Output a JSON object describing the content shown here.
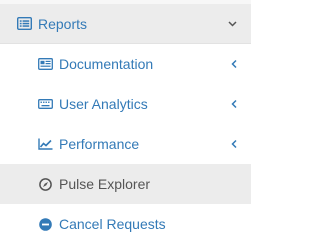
{
  "menu": {
    "header": {
      "label": "Reports",
      "icon": "list-alt-icon",
      "state_icon": "chevron-down-icon"
    },
    "items": [
      {
        "label": "Documentation",
        "icon": "newspaper-icon",
        "expand_icon": "chevron-left-icon"
      },
      {
        "label": "User Analytics",
        "icon": "keyboard-icon",
        "expand_icon": "chevron-left-icon"
      },
      {
        "label": "Performance",
        "icon": "line-chart-icon",
        "expand_icon": "chevron-left-icon"
      },
      {
        "label": "Pulse Explorer",
        "icon": "compass-icon",
        "active": true
      },
      {
        "label": "Cancel Requests",
        "icon": "minus-circle-icon"
      }
    ]
  },
  "colors": {
    "link": "#337ab7",
    "active_text": "#555555",
    "active_bg": "#ececec"
  }
}
